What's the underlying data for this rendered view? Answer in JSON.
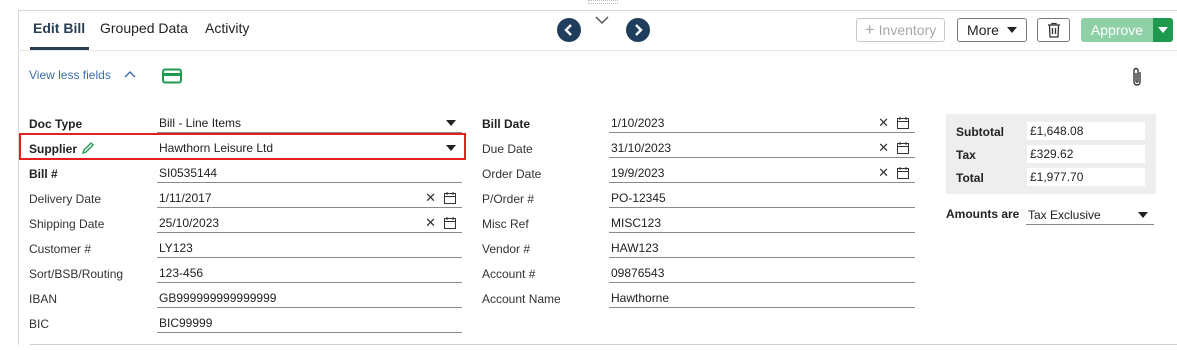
{
  "tabs": [
    {
      "label": "Edit Bill"
    },
    {
      "label": "Grouped Data"
    },
    {
      "label": "Activity"
    }
  ],
  "toolbar": {
    "inventory_label": "Inventory",
    "more_label": "More",
    "approve_label": "Approve"
  },
  "view_less_label": "View less fields",
  "left_fields": [
    {
      "label": "Doc Type",
      "value": "Bill - Line Items"
    },
    {
      "label": "Supplier",
      "value": "Hawthorn Leisure Ltd"
    },
    {
      "label": "Bill #",
      "value": "SI0535144"
    },
    {
      "label": "Delivery Date",
      "value": "1/11/2017"
    },
    {
      "label": "Shipping Date",
      "value": "25/10/2023"
    },
    {
      "label": "Customer #",
      "value": "LY123"
    },
    {
      "label": "Sort/BSB/Routing",
      "value": "123-456"
    },
    {
      "label": "IBAN",
      "value": "GB999999999999999"
    },
    {
      "label": "BIC",
      "value": "BIC99999"
    }
  ],
  "right_fields": [
    {
      "label": "Bill Date",
      "value": "1/10/2023"
    },
    {
      "label": "Due Date",
      "value": "31/10/2023"
    },
    {
      "label": "Order Date",
      "value": "19/9/2023"
    },
    {
      "label": "P/Order #",
      "value": "PO-12345"
    },
    {
      "label": "Misc Ref",
      "value": "MISC123"
    },
    {
      "label": "Vendor #",
      "value": "HAW123"
    },
    {
      "label": "Account #",
      "value": "09876543"
    },
    {
      "label": "Account Name",
      "value": "Hawthorne"
    }
  ],
  "totals": {
    "subtotal_label": "Subtotal",
    "subtotal_value": "£1,648.08",
    "tax_label": "Tax",
    "tax_value": "£329.62",
    "total_label": "Total",
    "total_value": "£1,977.70"
  },
  "amounts": {
    "label": "Amounts are",
    "value": "Tax Exclusive"
  },
  "colors": {
    "accent": "#1f3d5c",
    "approve": "#8fd1a6",
    "approve_dark": "#1e9a4f",
    "highlight": "#e22020",
    "link": "#3a6fb0"
  },
  "icons": [
    "chevron-left-icon",
    "chevron-down-icon",
    "chevron-right-icon",
    "plus-icon",
    "caret-down-icon",
    "trash-icon",
    "card-icon",
    "paperclip-icon",
    "pencil-icon",
    "clear-icon",
    "calendar-icon"
  ]
}
